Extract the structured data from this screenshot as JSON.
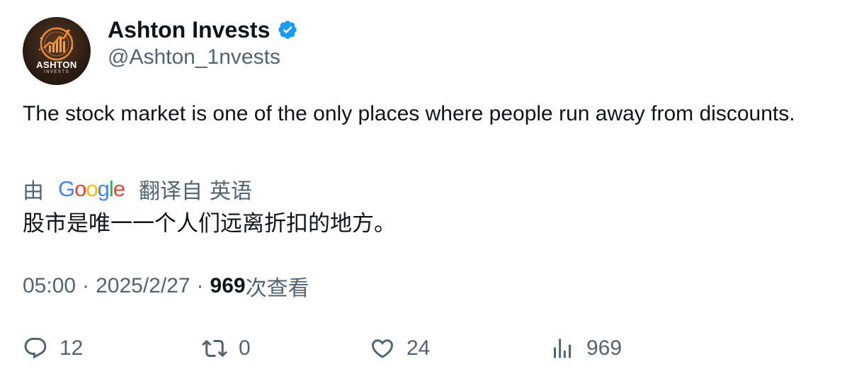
{
  "author": {
    "display_name": "Ashton Invests",
    "handle": "@Ashton_1nvests",
    "verified": true,
    "avatar": {
      "logo_text": "ASHTON",
      "logo_subtext": "INVESTS",
      "icon": "rising-chart-logo"
    }
  },
  "tweet": {
    "text": "The stock market is one of the only places where people run away from discounts."
  },
  "translation": {
    "prefix": "由",
    "provider": "Google",
    "label": "翻译自",
    "source_language": "英语",
    "text": "股市是唯一一个人们远离折扣的地方。"
  },
  "meta": {
    "time": "05:00",
    "separator": "·",
    "date": "2025/2/27",
    "views_count": "969",
    "views_label": "次查看"
  },
  "actions": {
    "replies": {
      "icon": "reply-icon",
      "count": "12"
    },
    "retweets": {
      "icon": "retweet-icon",
      "count": "0"
    },
    "likes": {
      "icon": "like-icon",
      "count": "24"
    },
    "views": {
      "icon": "views-icon",
      "count": "969"
    }
  },
  "colors": {
    "text_primary": "#0f1419",
    "text_secondary": "#536471",
    "verified_blue": "#1d9bf0"
  }
}
